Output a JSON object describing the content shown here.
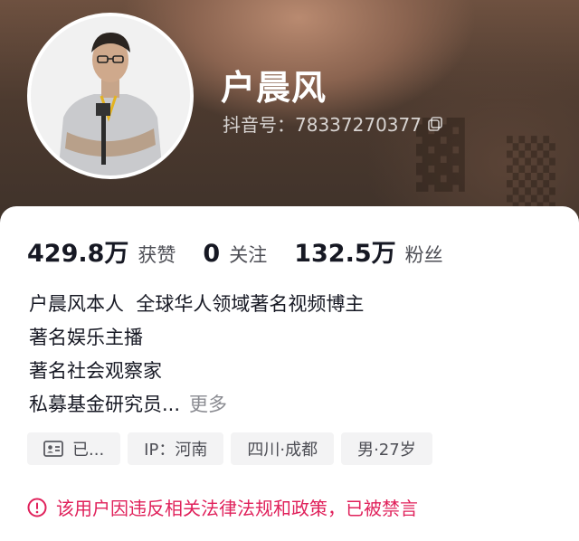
{
  "profile": {
    "name": "户晨风",
    "douyin_id_label": "抖音号：78337270377"
  },
  "stats": [
    {
      "value": "429.8万",
      "label": "获赞"
    },
    {
      "value": "0",
      "label": "关注"
    },
    {
      "value": "132.5万",
      "label": "粉丝"
    }
  ],
  "bio": {
    "lines": [
      "户晨风本人  全球华人领域著名视频博主",
      "著名娱乐主播",
      "著名社会观察家",
      "私募基金研究员..."
    ],
    "more_label": "更多"
  },
  "tags": {
    "verified": "已...",
    "ip": "IP：河南",
    "location": "四川·成都",
    "gender_age": "男·27岁"
  },
  "notice": {
    "text": "该用户因违反相关法律法规和政策，已被禁言",
    "color": "#e0215b",
    "icon": "alert-circle-icon"
  }
}
